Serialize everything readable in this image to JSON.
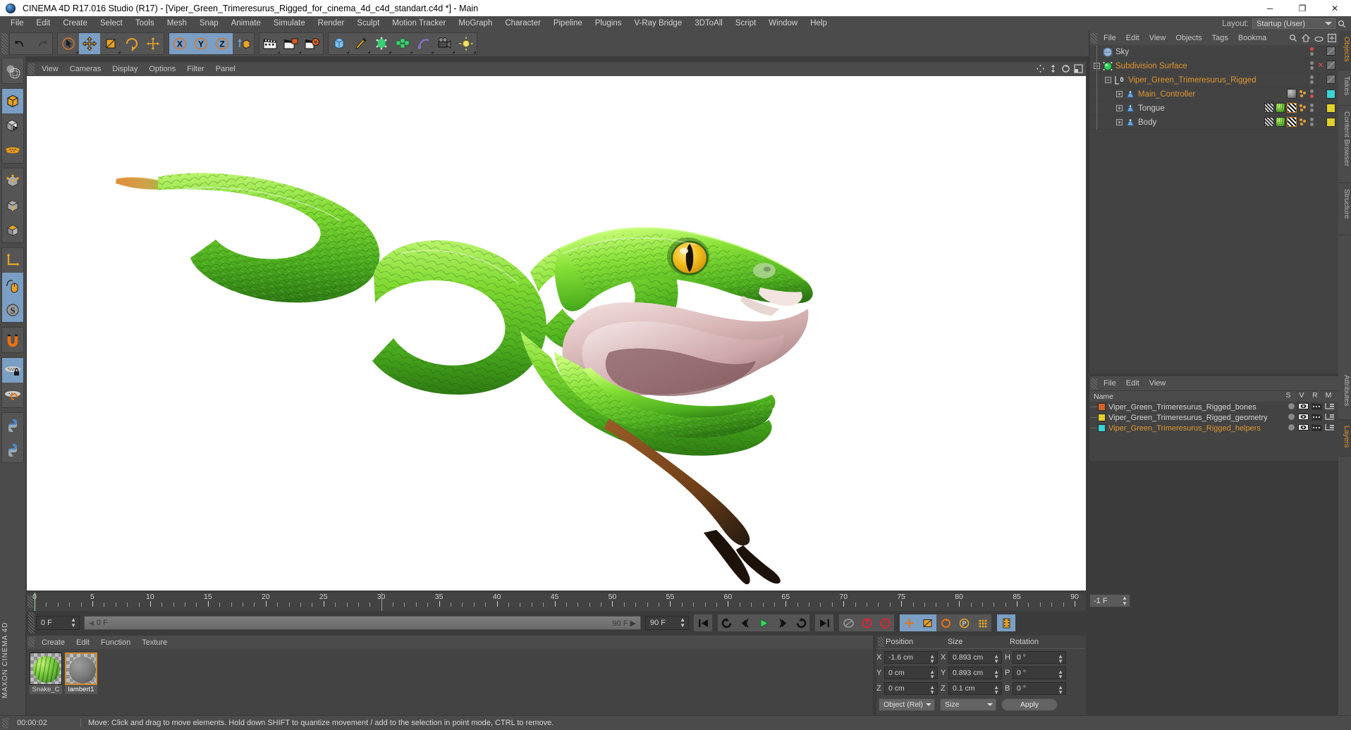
{
  "window": {
    "title": "CINEMA 4D R17.016 Studio (R17) - [Viper_Green_Trimeresurus_Rigged_for_cinema_4d_c4d_standart.c4d *] - Main",
    "minimize": "─",
    "maximize": "❐",
    "close": "✕"
  },
  "menubar": {
    "items": [
      "File",
      "Edit",
      "Create",
      "Select",
      "Tools",
      "Mesh",
      "Snap",
      "Animate",
      "Simulate",
      "Render",
      "Sculpt",
      "Motion Tracker",
      "MoGraph",
      "Character",
      "Pipeline",
      "Plugins",
      "V-Ray Bridge",
      "3DToAll",
      "Script",
      "Window",
      "Help"
    ],
    "layout_label": "Layout:",
    "layout_value": "Startup (User)"
  },
  "toolbar": {
    "groups": [
      {
        "name": "history",
        "buttons": [
          {
            "name": "undo-button",
            "icon": "undo",
            "on": false
          },
          {
            "name": "redo-button",
            "icon": "redo",
            "on": false
          }
        ]
      },
      {
        "name": "transform",
        "buttons": [
          {
            "name": "live-selection-button",
            "icon": "select",
            "on": false
          },
          {
            "name": "move-tool-button",
            "icon": "move",
            "on": true
          },
          {
            "name": "scale-tool-button",
            "icon": "scale",
            "on": false
          },
          {
            "name": "rotate-tool-button",
            "icon": "rotate",
            "on": false
          },
          {
            "name": "move-axis-button",
            "icon": "move2",
            "on": false
          }
        ]
      },
      {
        "name": "axis-locks",
        "buttons": [
          {
            "name": "lock-x-button",
            "icon": "X",
            "on": true
          },
          {
            "name": "lock-y-button",
            "icon": "Y",
            "on": true
          },
          {
            "name": "lock-z-button",
            "icon": "Z",
            "on": true
          },
          {
            "name": "world-object-coord-button",
            "icon": "worldcube",
            "on": false
          }
        ]
      },
      {
        "name": "render",
        "buttons": [
          {
            "name": "render-view-button",
            "icon": "clapper",
            "on": false
          },
          {
            "name": "render-region-button",
            "icon": "clapper-orange",
            "on": false
          },
          {
            "name": "render-settings-button",
            "icon": "clapper-gear",
            "on": false
          }
        ]
      },
      {
        "name": "create",
        "buttons": [
          {
            "name": "add-cube-button",
            "icon": "cube-blue",
            "on": false
          },
          {
            "name": "add-spline-button",
            "icon": "pen",
            "on": false
          },
          {
            "name": "add-generator-button",
            "icon": "cube-green",
            "on": false
          },
          {
            "name": "add-array-button",
            "icon": "array-green",
            "on": false
          },
          {
            "name": "add-deformer-button",
            "icon": "deformer",
            "on": false
          },
          {
            "name": "add-camera-button",
            "icon": "camera",
            "on": false
          },
          {
            "name": "add-light-button",
            "icon": "light",
            "on": false
          }
        ]
      }
    ]
  },
  "left_toolbar": {
    "buttons": [
      {
        "name": "make-editable-button",
        "icon": "globe-sphere",
        "on": false
      },
      {
        "name": "model-mode-button",
        "icon": "cube-orange-outline",
        "on": true
      },
      {
        "name": "texture-mode-button",
        "icon": "cube-checker",
        "on": false
      },
      {
        "name": "polygon-mesh-button",
        "icon": "orange-mesh",
        "on": false
      },
      {
        "name": "points-mode-button",
        "icon": "cube-points",
        "on": false
      },
      {
        "name": "edges-mode-button",
        "icon": "cube-edges",
        "on": false
      },
      {
        "name": "polygons-mode-button",
        "icon": "cube-solid-orange",
        "on": false
      },
      {
        "name": "world-axis-button",
        "icon": "axis-L",
        "on": false
      },
      {
        "name": "viewport-mouse-button",
        "icon": "mouse",
        "on": true
      },
      {
        "name": "snap-s-button",
        "icon": "circle-S",
        "on": true
      },
      {
        "name": "magnet-button",
        "icon": "magnet",
        "on": false
      },
      {
        "name": "lock-workplane-button",
        "icon": "grid-lock",
        "on": true
      },
      {
        "name": "workplane-rotate-button",
        "icon": "grid-rotate",
        "on": false
      },
      {
        "name": "python-script-button",
        "icon": "python",
        "on": false
      },
      {
        "name": "python-generator-button",
        "icon": "python2",
        "on": false
      }
    ],
    "brand": "MAXON CINEMA 4D"
  },
  "viewport": {
    "menus": [
      "View",
      "Cameras",
      "Display",
      "Options",
      "Filter",
      "Panel"
    ],
    "corner_icons": [
      "pan-icon",
      "zoom-icon",
      "orbit-icon",
      "maximize-icon"
    ],
    "scene_subject": "Green viper snake with open mouth and forked tongue"
  },
  "timeline": {
    "ticks_major": [
      0,
      5,
      10,
      15,
      20,
      25,
      30,
      35,
      40,
      45,
      50,
      55,
      60,
      65,
      70,
      75,
      80,
      85,
      90
    ],
    "range_start": 0,
    "range_end": 90,
    "current_frame_label": "0 F",
    "slider_left_label": "0 F",
    "slider_right_label": "90 F",
    "end_frame_field": "90 F",
    "preview_end_field": "-1 F",
    "transport": [
      {
        "name": "go-to-start-button",
        "icon": "skip-start"
      },
      {
        "name": "play-reverse-button",
        "icon": "loop-left"
      },
      {
        "name": "previous-frame-button",
        "icon": "step-back"
      },
      {
        "name": "play-forward-button",
        "icon": "play"
      },
      {
        "name": "next-frame-button",
        "icon": "step-fwd"
      },
      {
        "name": "play-loop-button",
        "icon": "loop-right"
      },
      {
        "name": "go-to-end-button",
        "icon": "skip-end"
      }
    ],
    "record_group": [
      {
        "name": "autokey-button",
        "icon": "key-grey"
      },
      {
        "name": "record-active-objects-button",
        "icon": "record-red"
      },
      {
        "name": "auto-keying-button",
        "icon": "question-red"
      }
    ],
    "param_group": [
      {
        "name": "record-position-button",
        "icon": "pos-arrows",
        "on": true
      },
      {
        "name": "record-scale-button",
        "icon": "scale-square",
        "on": true
      },
      {
        "name": "record-rotation-button",
        "icon": "rotate-ring",
        "on": false
      },
      {
        "name": "record-param-button",
        "icon": "p-ring",
        "on": false
      },
      {
        "name": "record-pla-button",
        "icon": "dots-grid",
        "on": false
      }
    ],
    "keyframe_button": {
      "name": "keyframe-selection-button",
      "icon": "film-strip"
    }
  },
  "materials": {
    "menus": [
      "Create",
      "Edit",
      "Function",
      "Texture"
    ],
    "items": [
      {
        "name": "Snake_C",
        "type": "green",
        "selected": false
      },
      {
        "name": "lambert1",
        "type": "grey",
        "selected": true
      }
    ]
  },
  "coordinates": {
    "headers": [
      "Position",
      "Size",
      "Rotation"
    ],
    "rows": [
      {
        "pos_label": "X",
        "pos_value": "-1.6 cm",
        "size_label": "X",
        "size_value": "0.893 cm",
        "rot_label": "H",
        "rot_value": "0 °"
      },
      {
        "pos_label": "Y",
        "pos_value": "0 cm",
        "size_label": "Y",
        "size_value": "0.893 cm",
        "rot_label": "P",
        "rot_value": "0 °"
      },
      {
        "pos_label": "Z",
        "pos_value": "0 cm",
        "size_label": "Z",
        "size_value": "0.1 cm",
        "rot_label": "B",
        "rot_value": "0 °"
      }
    ],
    "coord_system": "Object (Rel)",
    "size_mode": "Size",
    "apply_label": "Apply"
  },
  "object_manager": {
    "menus": [
      "File",
      "Edit",
      "View",
      "Objects",
      "Tags",
      "Bookma"
    ],
    "icons": [
      "search-icon",
      "home-icon",
      "eye-icon",
      "plus-box-icon"
    ],
    "rows": [
      {
        "name": "Sky",
        "depth": 0,
        "icon": "sky-sphere",
        "color": "grey",
        "expander": "none",
        "dots": [
          "red",
          "grey"
        ],
        "layer": "",
        "tags": [],
        "vis_x": false
      },
      {
        "name": "Subdivision Surface",
        "depth": 0,
        "icon": "subdiv-green",
        "color": "orange",
        "expander": "minus",
        "dots": [
          "grey",
          "grey"
        ],
        "layer": "",
        "tags": [],
        "vis_x": true
      },
      {
        "name": "Viper_Green_Trimeresurus_Rigged",
        "depth": 1,
        "icon": "null-zero",
        "color": "orange",
        "expander": "minus",
        "dots": [
          "grey",
          "grey"
        ],
        "layer": "",
        "tags": [],
        "vis_x": false
      },
      {
        "name": "Main_Controller",
        "depth": 2,
        "icon": "joint-blue",
        "color": "orange",
        "expander": "plus",
        "dots": [
          "grey",
          "red"
        ],
        "layer": "#3ad4d4",
        "tags": [
          "grey-sphere",
          "dots-orange"
        ],
        "vis_x": false
      },
      {
        "name": "Tongue",
        "depth": 2,
        "icon": "joint-blue",
        "color": "grey",
        "expander": "plus",
        "dots": [
          "grey",
          "grey"
        ],
        "layer": "#e2d12a",
        "tags": [
          "checker-dark",
          "green-sphere",
          "checker-light",
          "dots-orange"
        ],
        "vis_x": false
      },
      {
        "name": "Body",
        "depth": 2,
        "icon": "joint-blue",
        "color": "grey",
        "expander": "plus",
        "dots": [
          "grey",
          "grey"
        ],
        "layer": "#e2d12a",
        "tags": [
          "checker-dark",
          "green-sphere",
          "checker-light",
          "dots-orange"
        ],
        "vis_x": false
      }
    ]
  },
  "layer_manager": {
    "menus": [
      "File",
      "Edit",
      "View"
    ],
    "name_header": "Name",
    "columns": [
      "S",
      "V",
      "R",
      "M"
    ],
    "rows": [
      {
        "name": "Viper_Green_Trimeresurus_Rigged_bones",
        "color": "#d9622b",
        "highlight": false
      },
      {
        "name": "Viper_Green_Trimeresurus_Rigged_geometry",
        "color": "#e2d12a",
        "highlight": false
      },
      {
        "name": "Viper_Green_Trimeresurus_Rigged_helpers",
        "color": "#3ad4d4",
        "highlight": true
      }
    ]
  },
  "side_tabs": {
    "upper": [
      {
        "label": "Objects",
        "active": true
      },
      {
        "label": "Takes",
        "active": false
      },
      {
        "label": "Content Browser",
        "active": false
      },
      {
        "label": "Structure",
        "active": false
      }
    ],
    "lower": [
      {
        "label": "Attributes",
        "active": false
      },
      {
        "label": "Layers",
        "active": true
      }
    ]
  },
  "statusbar": {
    "time": "00:00:02",
    "message": "Move: Click and drag to move elements. Hold down SHIFT to quantize movement / add to the selection in point mode, CTRL to remove."
  },
  "colors": {
    "panel_bg": "#434343",
    "chrome_bg": "#4b4b4b",
    "accent_orange": "#e0952f",
    "highlight_blue": "#7a9ec4",
    "viewport_bg": "#ffffff"
  }
}
